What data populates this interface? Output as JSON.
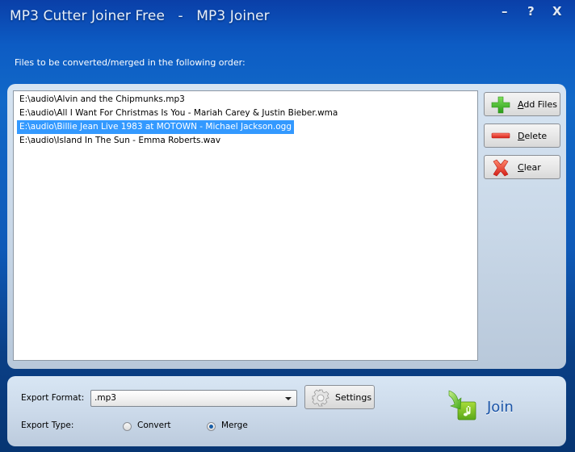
{
  "window": {
    "title": "MP3 Cutter Joiner Free   -   MP3 Joiner",
    "controls": {
      "minimize": "–",
      "help": "?",
      "close": "X"
    }
  },
  "files_label": "Files to be converted/merged in the following order:",
  "file_list": {
    "items": [
      {
        "path": "E:\\audio\\Alvin and the Chipmunks.mp3",
        "selected": false
      },
      {
        "path": "E:\\audio\\All I Want For Christmas Is You - Mariah Carey & Justin Bieber.wma",
        "selected": false
      },
      {
        "path": "E:\\audio\\Billie Jean Live 1983 at MOTOWN - Michael Jackson.ogg",
        "selected": true
      },
      {
        "path": "E:\\audio\\Island In The Sun - Emma Roberts.wav",
        "selected": false
      }
    ]
  },
  "buttons": {
    "add_files": {
      "mnemonic": "A",
      "rest": "dd Files",
      "icon": "plus-icon",
      "color": "#3cb523"
    },
    "delete": {
      "mnemonic": "D",
      "rest": "elete",
      "icon": "minus-icon",
      "color": "#e0322a"
    },
    "clear": {
      "mnemonic": "C",
      "rest": "lear",
      "icon": "x-icon",
      "color": "#e0322a"
    }
  },
  "export": {
    "format_label": "Export Format:",
    "format_value": ".mp3",
    "settings_label": "Settings",
    "type_label": "Export Type:",
    "type_options": [
      {
        "label": "Convert",
        "checked": false
      },
      {
        "label": "Merge",
        "checked": true
      }
    ]
  },
  "join": {
    "label": "Join",
    "icon": "join-music-arrow-icon"
  }
}
